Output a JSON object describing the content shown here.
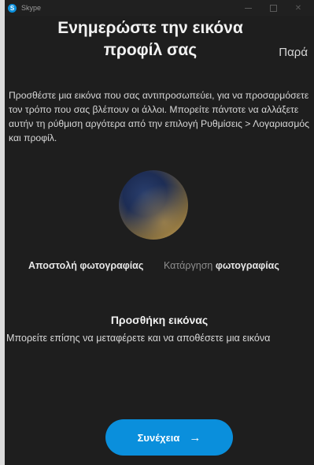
{
  "window": {
    "app_name": "Skype",
    "app_icon_letter": "S",
    "close_glyph": "✕"
  },
  "header": {
    "title": "Ενημερώστε την εικόνα προφίλ σας",
    "skip_label": "Παρά"
  },
  "description": "Προσθέστε μια εικόνα που σας αντιπροσωπεύει, για να προσαρμόσετε τον τρόπο που σας βλέπουν οι άλλοι. Μπορείτε πάντοτε να αλλάξετε αυτήν τη ρύθμιση αργότερα από την επιλογή Ρυθμίσεις > Λογαριασμός και προφίλ.",
  "photo_actions": {
    "upload_label": "Αποστολή φωτογραφίας",
    "remove_prefix": "Κατάργηση",
    "remove_suffix": "φωτογραφίας"
  },
  "add_image": {
    "title": "Προσθήκη εικόνας",
    "description": "Μπορείτε επίσης να μεταφέρετε και να αποθέσετε μια εικόνα"
  },
  "continue_button": {
    "label": "Συνέχεια",
    "icon": "arrow-right-icon",
    "arrow_glyph": "→"
  },
  "colors": {
    "accent": "#0a8fdc",
    "background": "#1e1e1e"
  }
}
